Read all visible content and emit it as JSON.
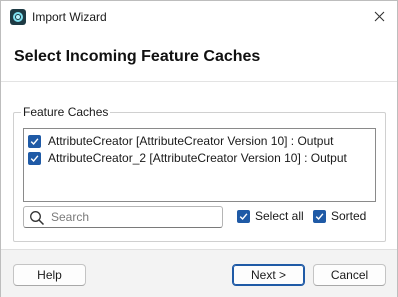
{
  "window": {
    "title": "Import Wizard",
    "accent": "#1f5aa6"
  },
  "header": {
    "title": "Select Incoming Feature Caches"
  },
  "group": {
    "label": "Feature Caches",
    "items": [
      {
        "label": "AttributeCreator [AttributeCreator Version 10] : Output",
        "checked": true
      },
      {
        "label": "AttributeCreator_2 [AttributeCreator Version 10] : Output",
        "checked": true
      }
    ]
  },
  "search": {
    "placeholder": "Search",
    "value": ""
  },
  "options": {
    "select_all": {
      "label": "Select all",
      "checked": true
    },
    "sorted": {
      "label": "Sorted",
      "checked": true
    }
  },
  "footer": {
    "help_label": "Help",
    "next_label": "Next >",
    "cancel_label": "Cancel"
  },
  "icons": {
    "app": "fme-app-icon",
    "close": "close-icon",
    "search": "search-icon",
    "check": "checkmark-icon"
  }
}
